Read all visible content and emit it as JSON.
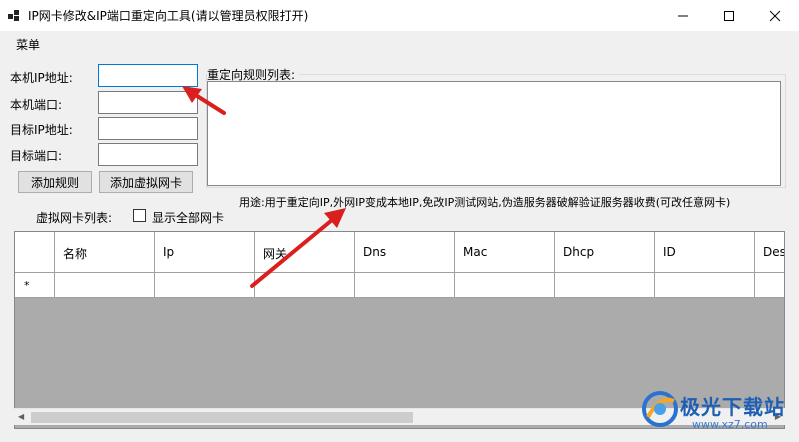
{
  "window": {
    "title": "IP网卡修改&IP端口重定向工具(请以管理员权限打开)",
    "minimize_glyph": "—",
    "maximize_glyph": "☐",
    "close_glyph": "✕"
  },
  "menu": {
    "items": [
      "菜单"
    ]
  },
  "form": {
    "local_ip_label": "本机IP地址:",
    "local_port_label": "本机端口:",
    "target_ip_label": "目标IP地址:",
    "target_port_label": "目标端口:",
    "local_ip_value": "",
    "local_port_value": "",
    "target_ip_value": "",
    "target_port_value": "",
    "add_rule_button": "添加规则",
    "add_virtual_nic_button": "添加虚拟网卡"
  },
  "rules": {
    "label": "重定向规则列表:"
  },
  "usage_note": "用途:用于重定向IP,外网IP变成本地IP,免改IP测试网站,伪造服务器破解验证服务器收费(可改任意网卡)",
  "nic_list": {
    "label": "虚拟网卡列表:",
    "show_all_label": "显示全部网卡",
    "show_all_checked": false,
    "columns": [
      "名称",
      "Ip",
      "网关",
      "Dns",
      "Mac",
      "Dhcp",
      "ID",
      "Des"
    ],
    "new_row_marker": "*"
  },
  "annotation_color": "#d9201e",
  "watermark": {
    "brand": "极光下载站",
    "url": "www.xz7.com"
  }
}
